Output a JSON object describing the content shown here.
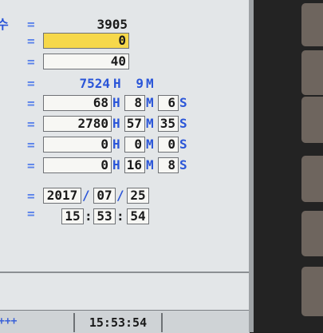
{
  "top": {
    "glyph": "수",
    "value": "3905"
  },
  "eq": "=",
  "row_highlight": {
    "value": "0"
  },
  "row_value2": {
    "value": "40"
  },
  "row_total": {
    "hours": "7524",
    "h": "H",
    "minutes": "9",
    "m": "M"
  },
  "timers": [
    {
      "hours": "68",
      "minutes": "8",
      "seconds": "6"
    },
    {
      "hours": "2780",
      "minutes": "57",
      "seconds": "35"
    },
    {
      "hours": "0",
      "minutes": "0",
      "seconds": "0"
    },
    {
      "hours": "0",
      "minutes": "16",
      "seconds": "8"
    }
  ],
  "units": {
    "h": "H",
    "m": "M",
    "s": "S"
  },
  "date": {
    "year": "2017",
    "month": "07",
    "day": "25",
    "sep": "/"
  },
  "time": {
    "hour": "15",
    "minute": "53",
    "second": "54",
    "sep": ":"
  },
  "status": {
    "left_marker": "+++",
    "clock": "15:53:54"
  }
}
